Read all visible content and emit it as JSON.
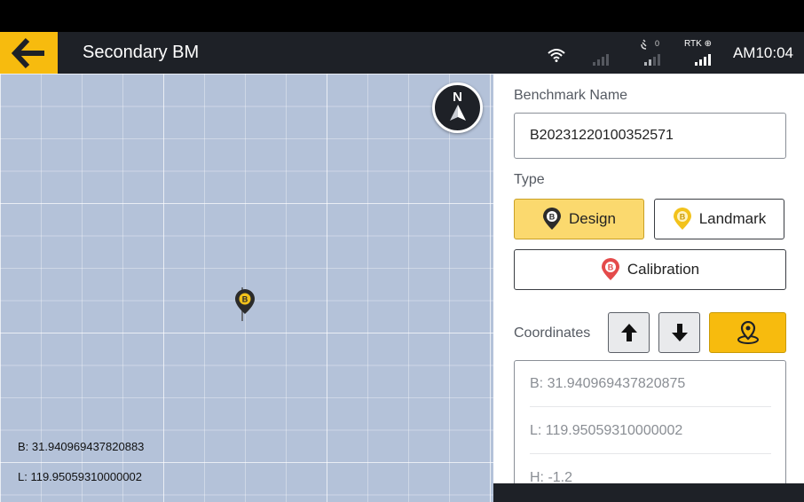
{
  "appbar": {
    "title": "Secondary BM",
    "satellite_count": "0",
    "rtk_label": "RTK",
    "time": "AM10:04"
  },
  "icons": {
    "back": "arrow-left-icon",
    "wifi": "wifi-icon",
    "satellite": "satellite-icon",
    "compass": "compass-icon",
    "map_marker": "benchmark-pin-icon"
  },
  "map": {
    "compass_label": "N",
    "lat_text": "B: 31.940969437820883",
    "lon_text": "L: 119.95059310000002"
  },
  "panel": {
    "name_label": "Benchmark Name",
    "name_value": "B20231220100352571",
    "type_label": "Type",
    "types": [
      {
        "label": "Design",
        "active": true,
        "pin_color": "#2b2b2b"
      },
      {
        "label": "Landmark",
        "active": false,
        "pin_color": "#f2c21b"
      },
      {
        "label": "Calibration",
        "active": false,
        "pin_color": "#e44a4a"
      }
    ],
    "pin_letter": "B",
    "coordinates_label": "Coordinates",
    "coordinates": [
      "B: 31.940969437820875",
      "L: 119.95059310000002",
      "H: -1.2"
    ]
  },
  "colors": {
    "accent": "#f7bb0e",
    "appbar": "#1e2127",
    "active_type_bg": "#fbd96e",
    "map_bg": "#b4c2d9"
  }
}
